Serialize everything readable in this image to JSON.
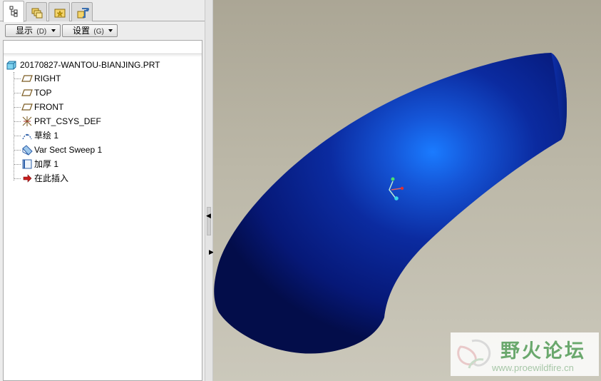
{
  "tabs": [
    {
      "name": "model-tree-tab",
      "icon": "model-tree-icon",
      "active": true
    },
    {
      "name": "folder-browser-tab",
      "icon": "folder-browser-icon",
      "active": false
    },
    {
      "name": "favorites-tab",
      "icon": "favorites-icon",
      "active": false
    },
    {
      "name": "connections-tab",
      "icon": "connections-icon",
      "active": false
    }
  ],
  "toolbar": {
    "display_label": "显示",
    "display_accel": "(D)",
    "settings_label": "设置",
    "settings_accel": "(G)"
  },
  "tree": {
    "root": "20170827-WANTOU-BIANJING.PRT",
    "items": [
      {
        "label": "RIGHT",
        "icon": "datum-plane-icon"
      },
      {
        "label": "TOP",
        "icon": "datum-plane-icon"
      },
      {
        "label": "FRONT",
        "icon": "datum-plane-icon"
      },
      {
        "label": "PRT_CSYS_DEF",
        "icon": "coordinate-system-icon"
      },
      {
        "label": "草绘 1",
        "icon": "sketch-icon"
      },
      {
        "label": "Var Sect Sweep 1",
        "icon": "var-sect-sweep-icon"
      },
      {
        "label": "加厚 1",
        "icon": "thicken-icon"
      },
      {
        "label": "在此插入",
        "icon": "insert-here-arrow-icon"
      }
    ]
  },
  "colors": {
    "model_body": "#0b1f8f",
    "model_highlight": "#1a7bff",
    "viewport_bg": "#bcb8a8",
    "insert_arrow": "#c81e1e"
  },
  "watermark": {
    "title": "野火论坛",
    "url": "www.proewildfire.cn"
  }
}
